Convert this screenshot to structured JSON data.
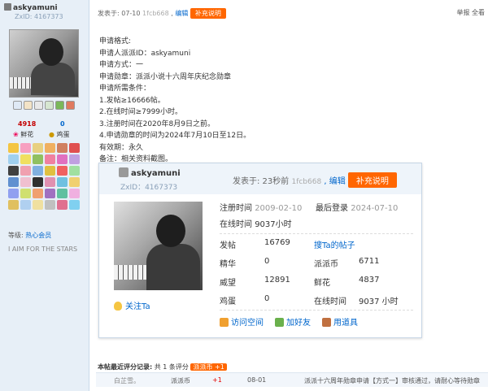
{
  "user": {
    "name": "askyamuni",
    "zxid": "ZxID: 4167373",
    "flowers_count": "4918",
    "flowers_label": "鲜花",
    "eggs_count": "0",
    "eggs_label": "鸡蛋",
    "level_label": "等级:",
    "level_value": "热心会员",
    "motto": "I AIM FOR THE STARS"
  },
  "post_header": {
    "posted_label": "发表于: 07-10",
    "floor": "1fcb668",
    "edit": "编辑",
    "supplement_btn": "补充说明",
    "report": "举报",
    "view_all": "全看"
  },
  "content": [
    "申请格式:",
    "申请人派派ID：askyamuni",
    "申请方式：一",
    "申请勋章：派派小说十六周年庆纪念勋章",
    "申请所需条件：",
    "1.发帖≥16666帖。",
    "2.在线时间≥7999小时。",
    "3.注册时间在2020年8月9日之前。",
    "4.申请勋章的时间为2024年7月10日至12日。",
    "有效期：永久",
    "备注：相关资料截图。"
  ],
  "card": {
    "name": "askyamuni",
    "zxid": "ZxID：4167373",
    "posted": "发表于: 23秒前",
    "floor": "1fcb668",
    "edit": ", 编辑",
    "supplement": "补充说明",
    "reg_label": "注册时间",
    "reg_value": "2009-02-10",
    "last_label": "最后登录",
    "last_value": "2024-07-10",
    "online_label": "在线时间",
    "online_value": "9037小时",
    "stats": [
      [
        "发帖",
        "16769",
        "搜Ta的帖子",
        ""
      ],
      [
        "精华",
        "0",
        "派派币",
        "6711"
      ],
      [
        "威望",
        "12891",
        "鲜花",
        "4837"
      ],
      [
        "鸡蛋",
        "0",
        "在线时间",
        "9037 小时"
      ]
    ],
    "follow": "关注Ta",
    "actions": [
      "访问空间",
      "加好友",
      "用道具"
    ]
  },
  "rating": {
    "label": "本帖最近评分记录:",
    "count": "共 1 条评分",
    "tag": "派派币 +1",
    "row": {
      "user": "白芷雪。",
      "item": "派派币",
      "value": "+1",
      "date": "08-01",
      "reason": "派派十六周年勋章申请【方式一】审核通过，请耐心等待勋章"
    }
  },
  "colors": {
    "accent": "#ff6600",
    "link": "#0066cc",
    "sidebar": "#e7eff7"
  }
}
